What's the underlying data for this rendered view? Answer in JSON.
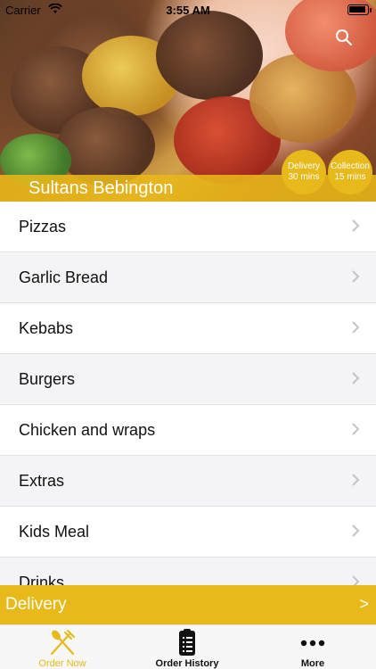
{
  "status_bar": {
    "carrier": "Carrier",
    "time": "3:55 AM"
  },
  "hero": {
    "restaurant_name": "Sultans Bebington",
    "delivery": {
      "label": "Delivery",
      "time": "30 mins"
    },
    "collection": {
      "label": "Collection",
      "time": "15 mins"
    }
  },
  "menu": {
    "items": [
      {
        "label": "Pizzas"
      },
      {
        "label": "Garlic Bread"
      },
      {
        "label": "Kebabs"
      },
      {
        "label": "Burgers"
      },
      {
        "label": "Chicken and wraps"
      },
      {
        "label": "Extras"
      },
      {
        "label": "Kids Meal"
      },
      {
        "label": "Drinks"
      }
    ]
  },
  "delivery_bar": {
    "label": "Delivery",
    "arrow": ">"
  },
  "tabbar": {
    "tabs": [
      {
        "label": "Order Now",
        "icon": "fork-knife-icon"
      },
      {
        "label": "Order History",
        "icon": "clipboard-icon"
      },
      {
        "label": "More",
        "icon": "more-icon"
      }
    ]
  },
  "colors": {
    "accent": "#e7b91a",
    "list_alt_bg": "#f4f4f6"
  }
}
